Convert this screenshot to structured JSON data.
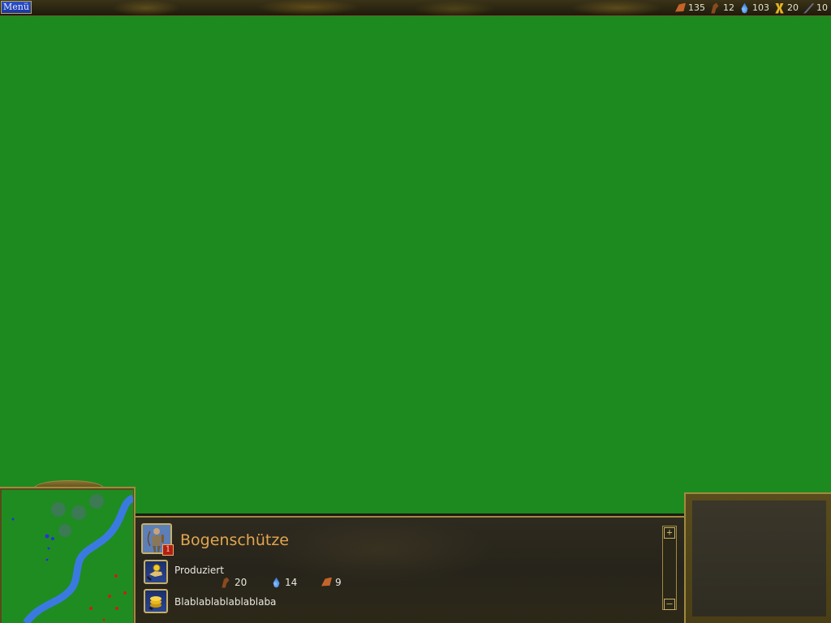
{
  "menu": {
    "label": "Menü"
  },
  "resources": [
    {
      "icon": "brick-icon",
      "value": "135"
    },
    {
      "icon": "wood-icon",
      "value": "12"
    },
    {
      "icon": "water-icon",
      "value": "103"
    },
    {
      "icon": "gold-icon",
      "value": "20"
    },
    {
      "icon": "sword-icon",
      "value": "10"
    }
  ],
  "unit": {
    "name": "Bogenschütze",
    "level": "1",
    "portrait_icon": "archer-portrait-icon"
  },
  "abilities": {
    "produce_label": "Produziert",
    "desc_label": "Blablablablablablaba"
  },
  "costs": [
    {
      "icon": "wood-icon",
      "value": "20"
    },
    {
      "icon": "water-icon",
      "value": "14"
    },
    {
      "icon": "brick-icon",
      "value": "9"
    }
  ],
  "scroll": {
    "up": "+",
    "down": "–"
  },
  "colors": {
    "map_green": "#1d8a1f",
    "river_blue": "#3a7ae0",
    "unit_name": "#e2a64f",
    "menu_blue": "#2a50c8"
  }
}
